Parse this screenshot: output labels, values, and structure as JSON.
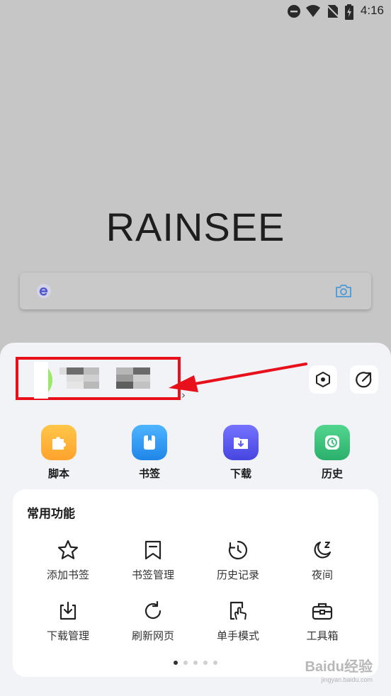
{
  "status_bar": {
    "time": "4:16"
  },
  "home": {
    "brand": "RAINSEE"
  },
  "menu": {
    "quick_actions": [
      {
        "label": "脚本",
        "color": "#ffb63a",
        "icon": "puzzle-icon"
      },
      {
        "label": "书签",
        "color": "#2f9bf3",
        "icon": "bookmark-icon"
      },
      {
        "label": "下载",
        "color": "#5b5af2",
        "icon": "download-folder-icon"
      },
      {
        "label": "历史",
        "color": "#3dc27e",
        "icon": "clock-icon"
      }
    ],
    "common": {
      "title": "常用功能",
      "items": [
        {
          "label": "添加书签",
          "icon": "star-icon"
        },
        {
          "label": "书签管理",
          "icon": "bookmark-outline-icon"
        },
        {
          "label": "历史记录",
          "icon": "history-icon"
        },
        {
          "label": "夜间",
          "icon": "moon-icon"
        },
        {
          "label": "下载管理",
          "icon": "download-icon"
        },
        {
          "label": "刷新网页",
          "icon": "refresh-icon"
        },
        {
          "label": "单手模式",
          "icon": "one-hand-icon"
        },
        {
          "label": "工具箱",
          "icon": "toolbox-icon"
        }
      ]
    },
    "pager": {
      "pages": 5,
      "active": 1
    }
  },
  "watermark": {
    "main": "Baidu经验",
    "sub": "jingyan.baidu.com"
  }
}
